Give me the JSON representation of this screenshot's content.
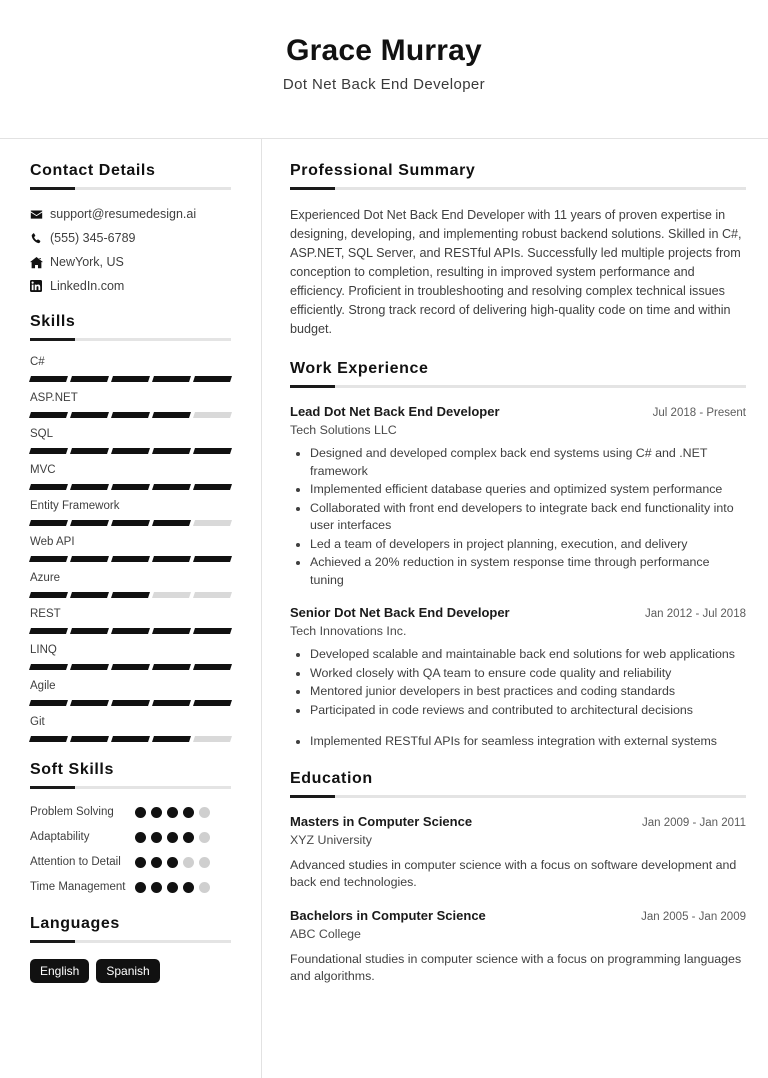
{
  "header": {
    "name": "Grace Murray",
    "title": "Dot Net Back End Developer"
  },
  "sidebar": {
    "contact": {
      "heading": "Contact Details",
      "items": [
        {
          "icon": "envelope-icon",
          "text": "support@resumedesign.ai"
        },
        {
          "icon": "phone-icon",
          "text": "(555) 345-6789"
        },
        {
          "icon": "home-icon",
          "text": "NewYork, US"
        },
        {
          "icon": "linkedin-icon",
          "text": "LinkedIn.com"
        }
      ]
    },
    "skills": {
      "heading": "Skills",
      "max": 5,
      "items": [
        {
          "name": "C#",
          "level": 5
        },
        {
          "name": "ASP.NET",
          "level": 4
        },
        {
          "name": "SQL",
          "level": 5
        },
        {
          "name": "MVC",
          "level": 5
        },
        {
          "name": "Entity Framework",
          "level": 4
        },
        {
          "name": "Web API",
          "level": 5
        },
        {
          "name": "Azure",
          "level": 3
        },
        {
          "name": "REST",
          "level": 5
        },
        {
          "name": "LINQ",
          "level": 5
        },
        {
          "name": "Agile",
          "level": 5
        },
        {
          "name": "Git",
          "level": 4
        }
      ]
    },
    "soft_skills": {
      "heading": "Soft Skills",
      "max": 5,
      "items": [
        {
          "name": "Problem Solving",
          "level": 4
        },
        {
          "name": "Adaptability",
          "level": 4
        },
        {
          "name": "Attention to Detail",
          "level": 3
        },
        {
          "name": "Time Management",
          "level": 4
        }
      ]
    },
    "languages": {
      "heading": "Languages",
      "items": [
        "English",
        "Spanish"
      ]
    }
  },
  "main": {
    "summary": {
      "heading": "Professional Summary",
      "text": "Experienced Dot Net Back End Developer with 11 years of proven expertise in designing, developing, and implementing robust backend solutions. Skilled in C#, ASP.NET, SQL Server, and RESTful APIs. Successfully led multiple projects from conception to completion, resulting in improved system performance and efficiency. Proficient in troubleshooting and resolving complex technical issues efficiently. Strong track record of delivering high-quality code on time and within budget."
    },
    "experience": {
      "heading": "Work Experience",
      "entries": [
        {
          "role": "Lead Dot Net Back End Developer",
          "date": "Jul 2018 - Present",
          "org": "Tech Solutions LLC",
          "bullets": [
            "Designed and developed complex back end systems using C# and .NET framework",
            "Implemented efficient database queries and optimized system performance",
            "Collaborated with front end developers to integrate back end functionality into user interfaces",
            "Led a team of developers in project planning, execution, and delivery",
            "Achieved a 20% reduction in system response time through performance tuning"
          ],
          "extra_bullets": []
        },
        {
          "role": "Senior Dot Net Back End Developer",
          "date": "Jan 2012 - Jul 2018",
          "org": "Tech Innovations Inc.",
          "bullets": [
            "Developed scalable and maintainable back end solutions for web applications",
            "Worked closely with QA team to ensure code quality and reliability",
            "Mentored junior developers in best practices and coding standards",
            "Participated in code reviews and contributed to architectural decisions"
          ],
          "extra_bullets": [
            "Implemented RESTful APIs for seamless integration with external systems"
          ]
        }
      ]
    },
    "education": {
      "heading": "Education",
      "entries": [
        {
          "degree": "Masters in Computer Science",
          "date": "Jan 2009 - Jan 2011",
          "school": "XYZ University",
          "description": "Advanced studies in computer science with a focus on software development and back end technologies."
        },
        {
          "degree": "Bachelors in Computer Science",
          "date": "Jan 2005 - Jan 2009",
          "school": "ABC College",
          "description": "Foundational studies in computer science with a focus on programming languages and algorithms."
        }
      ]
    }
  },
  "colors": {
    "accent": "#111111",
    "rule": "#e4e4e4",
    "text": "#3f3f3f",
    "muted": "#5c5c5c"
  }
}
